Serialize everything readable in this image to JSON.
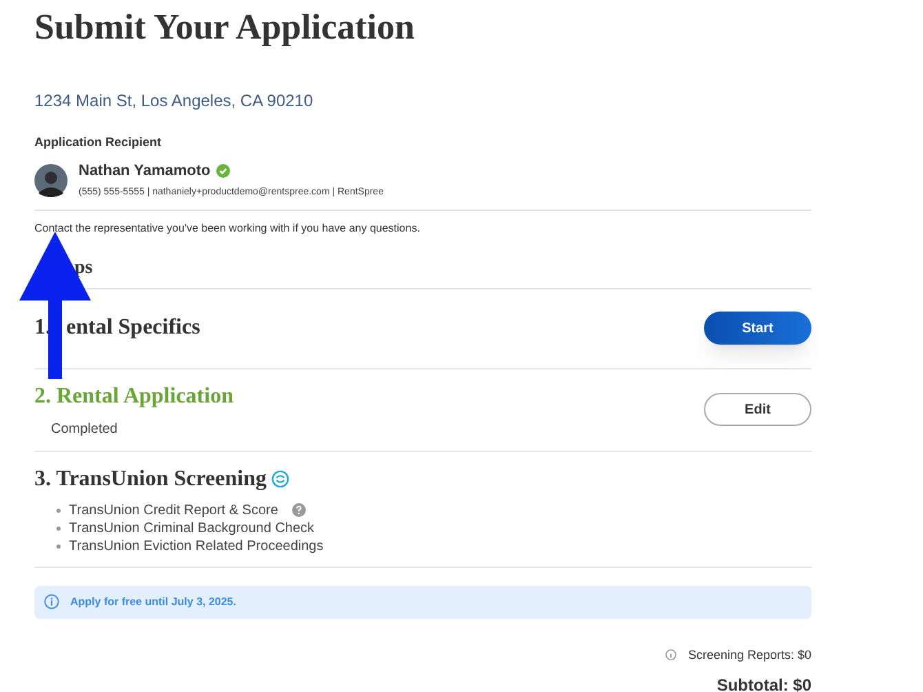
{
  "title": "Submit Your Application",
  "address": "1234 Main St, Los Angeles, CA 90210",
  "recipient": {
    "heading": "Application Recipient",
    "name": "Nathan Yamamoto",
    "verified": true,
    "details": "(555) 555-5555 | nathaniely+productdemo@rentspree.com | RentSpree"
  },
  "contact_note": "Contact the representative you've been working with if you have any questions.",
  "steps_heading_parts": [
    "ps"
  ],
  "steps": [
    {
      "title_parts": [
        "1.",
        "ental Specifics"
      ],
      "completed": false,
      "button": "Start",
      "kind": "primary"
    },
    {
      "title_parts": [
        "2. Rental Application"
      ],
      "completed": true,
      "status": "Completed",
      "button": "Edit",
      "kind": "outline"
    },
    {
      "title_parts": [
        "3. TransUnion Screening"
      ],
      "completed": false,
      "kind": "screening",
      "items": [
        {
          "label": "TransUnion Credit Report & Score",
          "help": true
        },
        {
          "label": "TransUnion Criminal Background Check",
          "help": false
        },
        {
          "label": "TransUnion Eviction Related Proceedings",
          "help": false
        }
      ]
    }
  ],
  "notice": "Apply for free until July 3, 2025.",
  "summary": {
    "screening_reports": "Screening Reports: $0",
    "subtotal": "Subtotal: $0"
  }
}
